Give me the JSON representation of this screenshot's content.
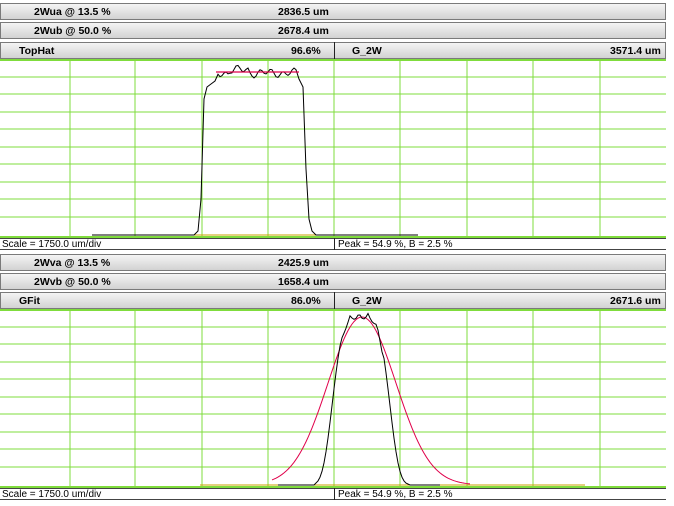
{
  "panel1": {
    "w_a_label": "2Wua @ 13.5 %",
    "w_a_value": "2836.5 um",
    "w_b_label": "2Wub @ 50.0 %",
    "w_b_value": "2678.4 um",
    "fit_label": "TopHat",
    "fit_value": "96.6%",
    "g_label": "G_2W",
    "g_value": "3571.4 um",
    "scale": "Scale = 1750.0 um/div",
    "peak": "Peak = 54.9 %,  B = 2.5 %"
  },
  "panel2": {
    "w_a_label": "2Wva @ 13.5 %",
    "w_a_value": "2425.9 um",
    "w_b_label": "2Wvb @ 50.0 %",
    "w_b_value": "1658.4 um",
    "fit_label": "GFit",
    "fit_value": "86.0%",
    "g_label": "G_2W",
    "g_value": "2671.6 um",
    "scale": "Scale = 1750.0 um/div",
    "peak": "Peak = 54.9 %,  B = 2.5 %"
  },
  "colors": {
    "grid": "#7fdc3c",
    "profile": "#000000",
    "fit": "#e0004a",
    "baseline": "#c8a000"
  }
}
